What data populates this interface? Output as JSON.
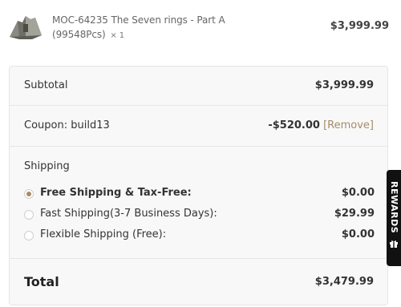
{
  "cart_item": {
    "name": "MOC-64235 The Seven rings - Part A (99548Pcs)",
    "quantity": "× 1",
    "price": "$3,999.99",
    "thumbnail_icon": "lego-model-thumbnail"
  },
  "totals": {
    "subtotal_label": "Subtotal",
    "subtotal_value": "$3,999.99",
    "coupon_label": "Coupon: build13",
    "coupon_amount": "-$520.00",
    "coupon_remove": "[Remove]",
    "shipping_title": "Shipping",
    "shipping_options": [
      {
        "label": "Free Shipping & Tax-Free:",
        "price": "$0.00",
        "selected": true
      },
      {
        "label": "Fast Shipping(3-7 Business Days):",
        "price": "$29.99",
        "selected": false
      },
      {
        "label": "Flexible Shipping (Free):",
        "price": "$0.00",
        "selected": false
      }
    ],
    "total_label": "Total",
    "total_value": "$3,479.99"
  },
  "rewards_tab": {
    "label": "REWARDS",
    "icon": "gift-icon"
  },
  "colors": {
    "accent": "#a88a68",
    "panel_bg": "#f8f8f8",
    "border": "#e6e6e6"
  }
}
